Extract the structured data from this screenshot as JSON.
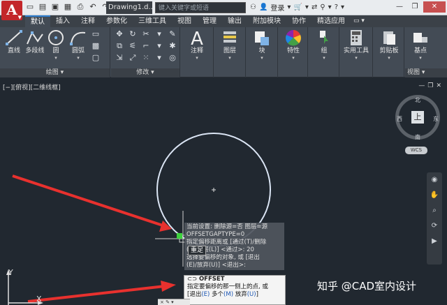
{
  "titlebar": {
    "app_letter": "A",
    "document_title": "Drawing1.d...",
    "search_placeholder": "键入关键字或短语",
    "login": "登录",
    "qat_icons": [
      "new-icon",
      "open-icon",
      "save-icon",
      "saveas-icon",
      "print-icon",
      "undo-icon",
      "redo-icon"
    ]
  },
  "ribbon": {
    "tabs": [
      "默认",
      "插入",
      "注释",
      "参数化",
      "三维工具",
      "视图",
      "管理",
      "输出",
      "附加模块",
      "协作",
      "精选应用"
    ],
    "active_tab": "默认",
    "tab_overflow": "▭ ▾",
    "draw_panel": {
      "title": "绘图 ▾",
      "tools": [
        "直线",
        "多段线",
        "圆",
        "圆弧"
      ]
    },
    "modify_panel": {
      "title": "修改 ▾"
    },
    "annotation": {
      "label": "注释"
    },
    "layers": {
      "label": "图层"
    },
    "block": {
      "label": "块"
    },
    "properties": {
      "label": "特性"
    },
    "groups": {
      "label": "组"
    },
    "utilities": {
      "label": "实用工具"
    },
    "clipboard": {
      "label": "剪贴板"
    },
    "base": {
      "label": "基点"
    },
    "view_panel": {
      "title": "视图 ▾"
    }
  },
  "viewport": {
    "label": "[−][俯视][二维线框]",
    "viewcube": {
      "face": "上",
      "north": "北",
      "south": "南",
      "east": "东",
      "west": "西"
    },
    "wcs": "WCS",
    "cmd_history": [
      "当前设置: 删除源=否  图层=源",
      "OFFSETGAPTYPE=0",
      "指定偏移距离或 [通过(T)/删除",
      "(E)/图层(L)] <通过>:  20",
      "选择要偏移的对象, 或 [退出",
      "(E)/放弃(U)] <退出>:"
    ],
    "tooltip": "重足",
    "command": {
      "name": "OFFSET",
      "prompt_line1": "指定要偏移的那一侧上的点, 或",
      "prompt_line2_prefix": "[退出",
      "opt_exit": "(E)",
      "multiple": " 多个",
      "opt_multiple": "(M)",
      "undo": " 放弃",
      "opt_undo": "(U)",
      "suffix": "]"
    },
    "cmd_input_text": "× ✎ ▾",
    "watermark": "知乎 @CAD室内设计",
    "ucs": {
      "x": "X",
      "y": "Y"
    }
  },
  "colors": {
    "canvas": "#212830",
    "ribbon": "#434b55",
    "app_button": "#c3262a",
    "circle": "#dce6f5",
    "arrow": "#e8312e"
  }
}
